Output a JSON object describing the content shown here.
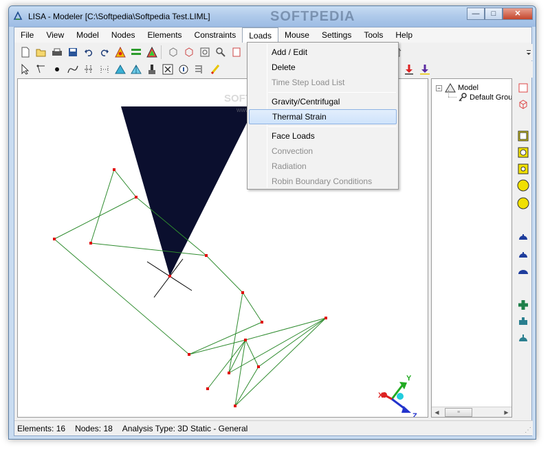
{
  "window": {
    "title": "LISA - Modeler [C:\\Softpedia\\Softpedia Test.LIML]",
    "watermark": "SOFTPEDIA",
    "minimize_label": "—",
    "maximize_label": "□",
    "close_label": "✕"
  },
  "menubar": {
    "items": [
      "File",
      "View",
      "Model",
      "Nodes",
      "Elements",
      "Constraints",
      "Loads",
      "Mouse",
      "Settings",
      "Tools",
      "Help"
    ],
    "active": "Loads"
  },
  "loads_menu": {
    "items": [
      {
        "label": "Add / Edit",
        "enabled": true
      },
      {
        "label": "Delete",
        "enabled": true
      },
      {
        "label": "Time Step Load List",
        "enabled": false
      },
      {
        "label": "Gravity/Centrifugal",
        "enabled": true
      },
      {
        "label": "Thermal Strain",
        "enabled": true,
        "highlighted": true
      },
      {
        "label": "Face Loads",
        "enabled": true
      },
      {
        "label": "Convection",
        "enabled": false
      },
      {
        "label": "Radiation",
        "enabled": false
      },
      {
        "label": "Robin Boundary Conditions",
        "enabled": false
      }
    ]
  },
  "canvas": {
    "watermark": "SOFTPEDIA",
    "watermark_sub": "www.softpedia.com",
    "axes": {
      "x": "X",
      "y": "Y",
      "z": "Z"
    },
    "colors": {
      "mesh": "#2e8b2e",
      "node": "#e00000",
      "shape": "#0b0f2e"
    }
  },
  "tree": {
    "root_label": "Model",
    "child_label": "Default Grou",
    "expander": "−"
  },
  "statusbar": {
    "elements_label": "Elements:",
    "elements_value": "16",
    "nodes_label": "Nodes:",
    "nodes_value": "18",
    "analysis_label": "Analysis Type:",
    "analysis_value": "3D Static - General"
  },
  "toolbar": {
    "row1_icons": [
      "new-file-icon",
      "open-folder-icon",
      "print-icon",
      "save-icon",
      "undo-icon",
      "redo-icon",
      "solve-icon",
      "equals-icon",
      "results-icon"
    ],
    "row2_icons": [
      "select-icon",
      "node-icon",
      "point-icon",
      "curve-icon",
      "split-icon",
      "dotted-icon",
      "triangle-icon",
      "triangle-alt-icon",
      "brush-icon",
      "delete-box-icon",
      "info-icon",
      "filter-icon",
      "pen-icon"
    ]
  }
}
